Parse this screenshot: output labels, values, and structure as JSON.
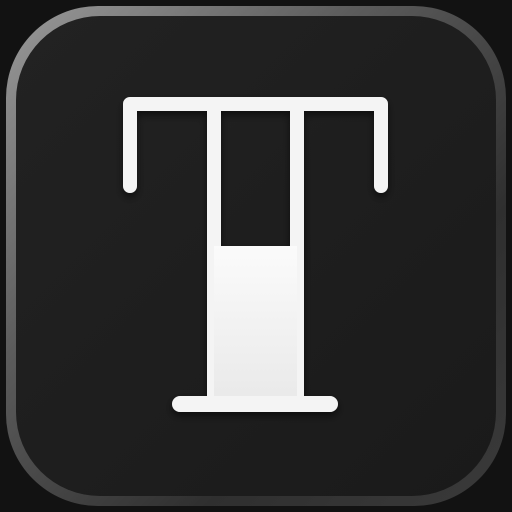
{
  "app_icon": {
    "name": "T",
    "glyph": "T",
    "icon": "letter-t-icon",
    "colors": {
      "background_outer": "#121212",
      "tile_bezel_light": "#8c8c8c",
      "tile_bezel_dark": "#2a2a2a",
      "tile_face": "#1c1c1c",
      "glyph_stroke": "#f4f4f4",
      "glyph_fill": "#f1f1f1"
    }
  }
}
